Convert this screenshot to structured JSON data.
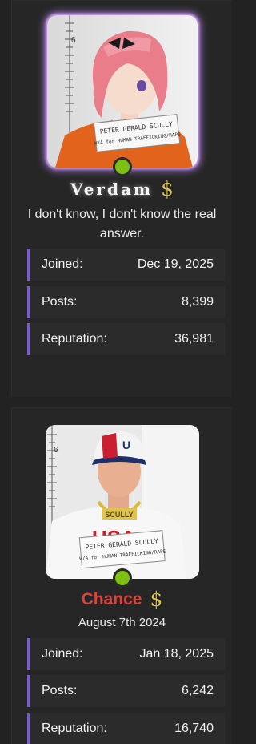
{
  "profiles": [
    {
      "name": "Verdam",
      "badge": "$",
      "subtitle": "I don't know, I don't know the real answer.",
      "stats": [
        {
          "label": "Joined:",
          "value": "Dec 19, 2025"
        },
        {
          "label": "Posts:",
          "value": "8,399"
        },
        {
          "label": "Reputation:",
          "value": "36,981"
        }
      ],
      "sign_text": [
        "PETER GERALD SCULLY",
        "W/A for HUMAN TRAFFICKING/RAPE"
      ],
      "colors": {
        "name": "#f4f4f4",
        "avatar_glow": "#b783e6",
        "status": "#7cc013"
      }
    },
    {
      "name": "Chance",
      "badge": "$",
      "subtitle": "August 7th 2024",
      "stats": [
        {
          "label": "Joined:",
          "value": "Jan 18, 2025"
        },
        {
          "label": "Posts:",
          "value": "6,242"
        },
        {
          "label": "Reputation:",
          "value": "16,740"
        }
      ],
      "sign_text": [
        "PETER GERALD SCULLY",
        "W/A for HUMAN TRAFFICKING/RAPE"
      ],
      "chain_text": "SCULLY",
      "shirt_text": "USA",
      "colors": {
        "name": "#e0413a",
        "status": "#7cc013"
      }
    }
  ],
  "stat_accent": "#7a5cc8"
}
